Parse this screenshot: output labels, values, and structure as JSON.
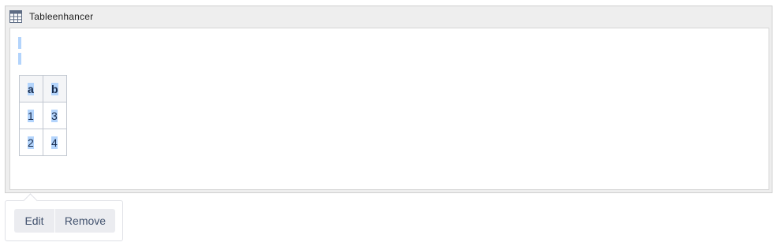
{
  "macro": {
    "title": "Tableenhancer",
    "icon": "table-icon",
    "table": {
      "headers": [
        "a",
        "b"
      ],
      "rows": [
        [
          "1",
          "3"
        ],
        [
          "2",
          "4"
        ]
      ]
    }
  },
  "toolbar": {
    "edit_label": "Edit",
    "remove_label": "Remove"
  },
  "colors": {
    "selection": "#b3d4fc",
    "macro_background": "#eeeeee",
    "button_background": "#ebecf0"
  }
}
